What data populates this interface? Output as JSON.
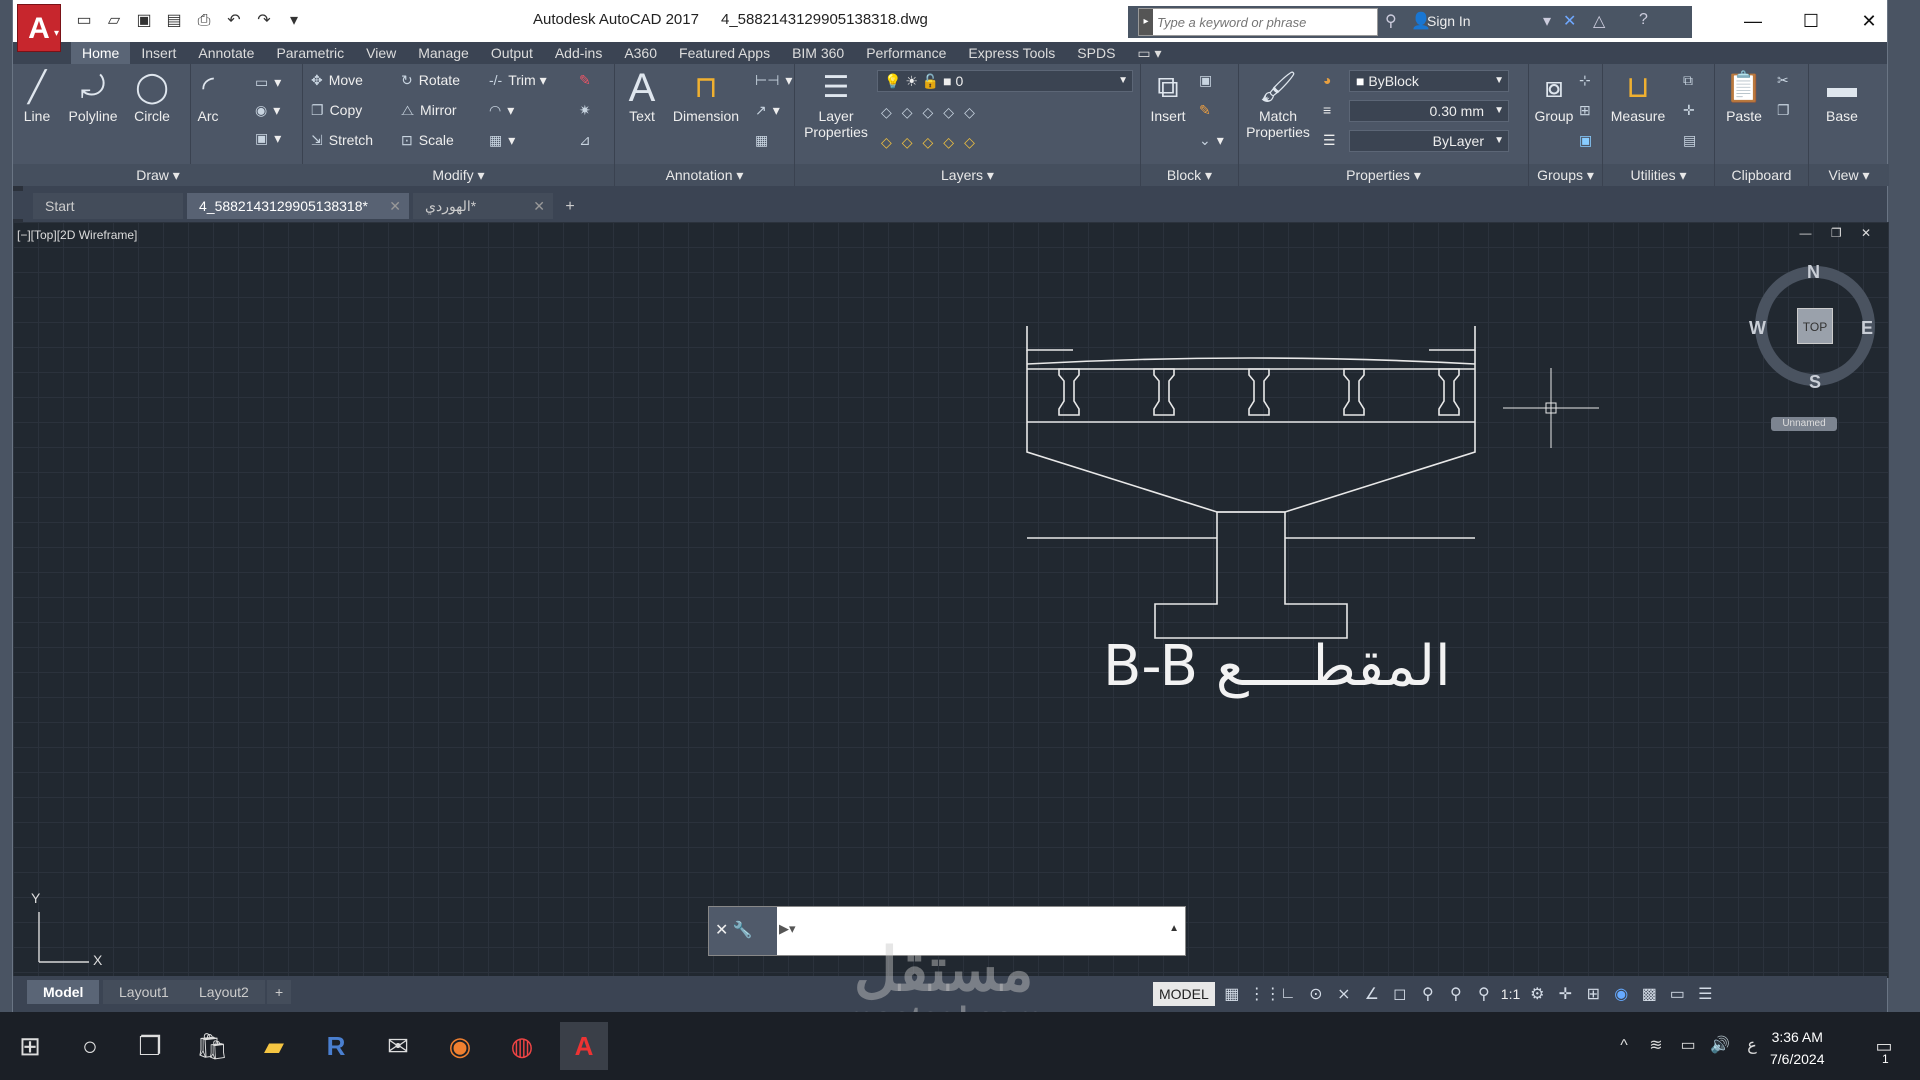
{
  "app": {
    "title": "Autodesk AutoCAD 2017",
    "filename": "4_5882143129905138318.dwg",
    "logo": "A"
  },
  "search": {
    "placeholder": "Type a keyword or phrase"
  },
  "account": {
    "signin": "Sign In"
  },
  "ribbon_tabs": [
    "Home",
    "Insert",
    "Annotate",
    "Parametric",
    "View",
    "Manage",
    "Output",
    "Add-ins",
    "A360",
    "Featured Apps",
    "BIM 360",
    "Performance",
    "Express Tools",
    "SPDS"
  ],
  "draw": {
    "line": "Line",
    "polyline": "Polyline",
    "circle": "Circle",
    "arc": "Arc",
    "title": "Draw"
  },
  "modify": {
    "move": "Move",
    "copy": "Copy",
    "stretch": "Stretch",
    "rotate": "Rotate",
    "mirror": "Mirror",
    "scale": "Scale",
    "trim": "Trim",
    "title": "Modify"
  },
  "annotation": {
    "text": "Text",
    "dimension": "Dimension",
    "title": "Annotation"
  },
  "layers": {
    "properties": "Layer Properties",
    "current": "0",
    "title": "Layers"
  },
  "block": {
    "insert": "Insert",
    "title": "Block"
  },
  "properties": {
    "match": "Match Properties",
    "color": "ByBlock",
    "lineweight": "0.30 mm",
    "linetype": "ByLayer",
    "title": "Properties"
  },
  "groups": {
    "group": "Group",
    "title": "Groups"
  },
  "utilities": {
    "measure": "Measure",
    "title": "Utilities"
  },
  "clipboard": {
    "paste": "Paste",
    "title": "Clipboard"
  },
  "view": {
    "base": "Base",
    "title": "View"
  },
  "doc_tabs": [
    "Start",
    "4_5882143129905138318*",
    "الهوردي*"
  ],
  "viewport": {
    "label": "[−][Top][2D Wireframe]"
  },
  "viewcube": {
    "n": "N",
    "s": "S",
    "e": "E",
    "w": "W",
    "top": "TOP",
    "ucs": "Unnamed"
  },
  "drawing": {
    "section_label": "المقطــــع B-B"
  },
  "ucs": {
    "x": "X",
    "y": "Y"
  },
  "layout_tabs": [
    "Model",
    "Layout1",
    "Layout2"
  ],
  "status": {
    "model": "MODEL",
    "scale": "1:1"
  },
  "taskbar": {
    "time": "3:36 AM",
    "date": "7/6/2024",
    "lang": "ع",
    "notifications": "1"
  },
  "watermark": {
    "arabic": "مستقل",
    "latin": "mostaql.com"
  }
}
